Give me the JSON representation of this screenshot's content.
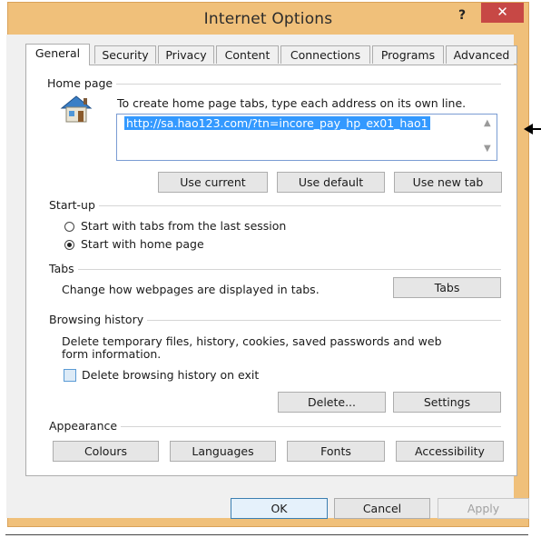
{
  "window": {
    "title": "Internet Options",
    "help_label": "?",
    "close_label": "✕"
  },
  "tabs": [
    {
      "label": "General",
      "active": true
    },
    {
      "label": "Security",
      "active": false
    },
    {
      "label": "Privacy",
      "active": false
    },
    {
      "label": "Content",
      "active": false
    },
    {
      "label": "Connections",
      "active": false
    },
    {
      "label": "Programs",
      "active": false
    },
    {
      "label": "Advanced",
      "active": false
    }
  ],
  "home_page": {
    "group_label": "Home page",
    "instruction": "To create home page tabs, type each address on its own line.",
    "url_value": "http://sa.hao123.com/?tn=incore_pay_hp_ex01_hao1",
    "buttons": {
      "use_current": "Use current",
      "use_default": "Use default",
      "use_new_tab": "Use new tab"
    },
    "icon": "house-icon"
  },
  "startup": {
    "group_label": "Start-up",
    "options": [
      {
        "label": "Start with tabs from the last session",
        "selected": false
      },
      {
        "label": "Start with home page",
        "selected": true
      }
    ]
  },
  "tabs_group": {
    "group_label": "Tabs",
    "description": "Change how webpages are displayed in tabs.",
    "button": "Tabs"
  },
  "browsing_history": {
    "group_label": "Browsing history",
    "description_line1": "Delete temporary files, history, cookies, saved passwords and web",
    "description_line2": "form information.",
    "checkbox_label": "Delete browsing history on exit",
    "checkbox_checked": false,
    "delete_button": "Delete...",
    "settings_button": "Settings"
  },
  "appearance": {
    "group_label": "Appearance",
    "buttons": [
      "Colours",
      "Languages",
      "Fonts",
      "Accessibility"
    ]
  },
  "footer": {
    "ok": "OK",
    "cancel": "Cancel",
    "apply": "Apply"
  },
  "colors": {
    "frame": "#f0c07a",
    "close": "#c74845",
    "selection": "#3399ff"
  }
}
